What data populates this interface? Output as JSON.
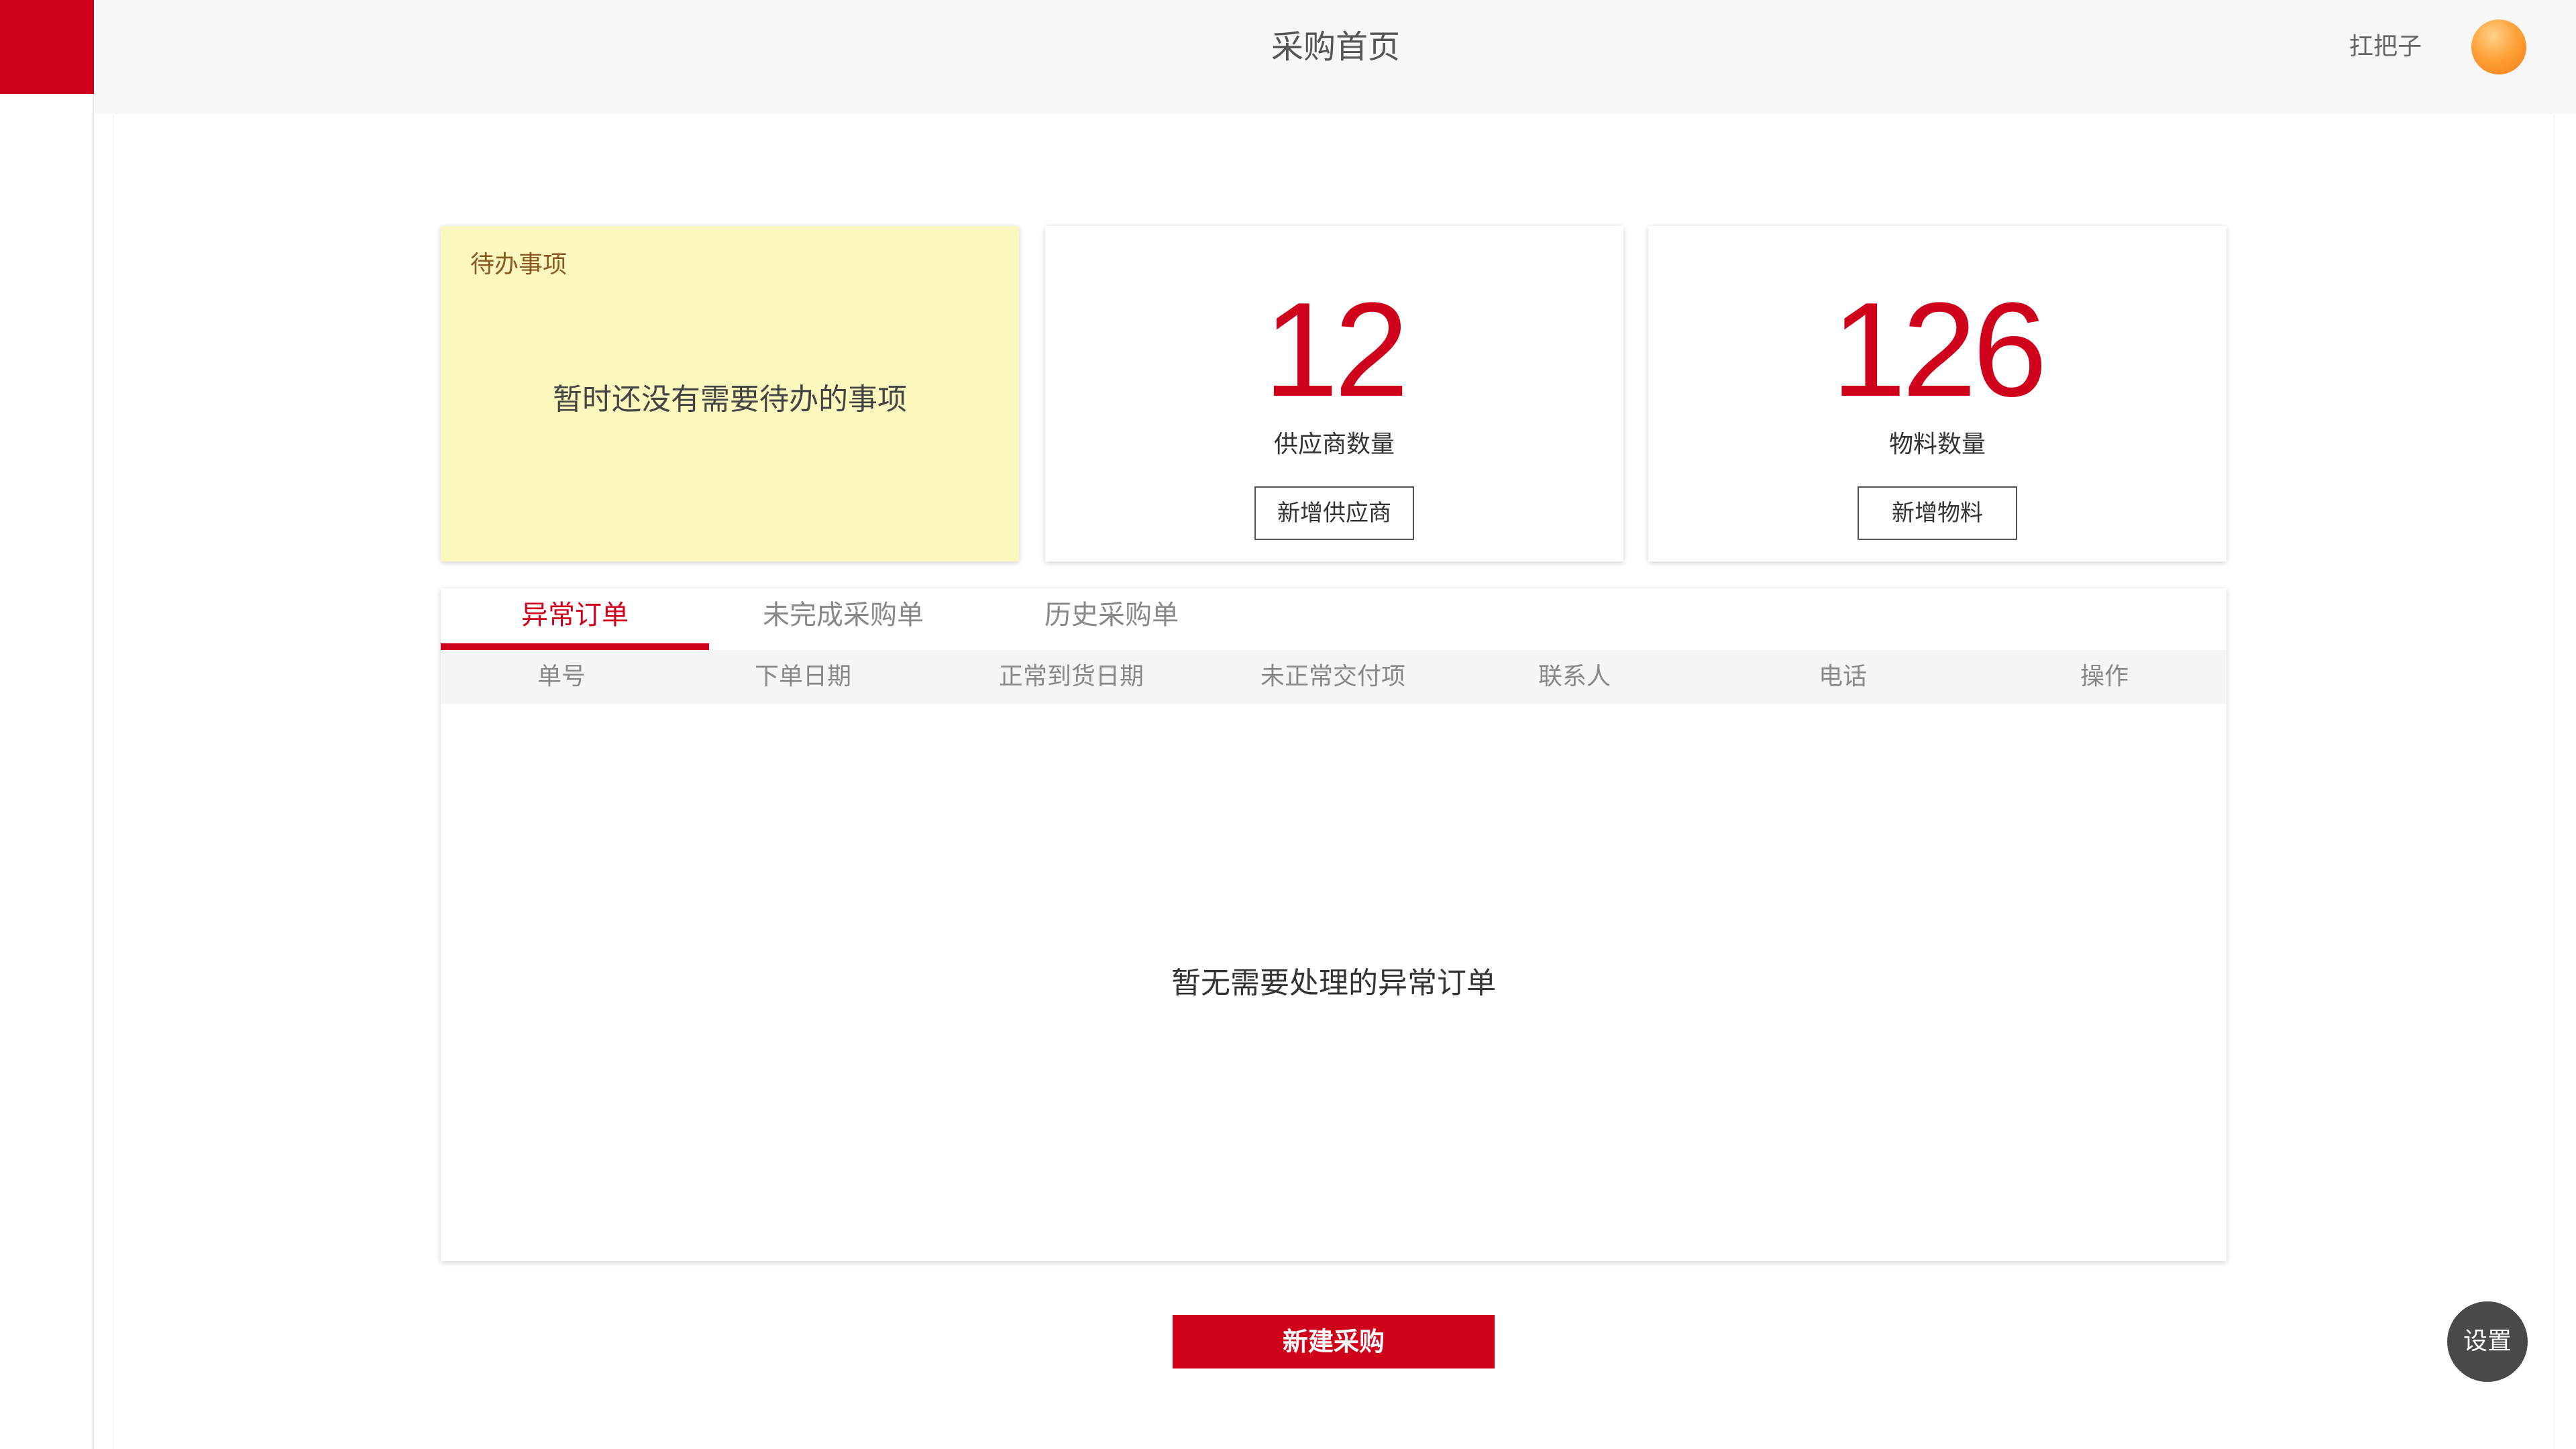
{
  "header": {
    "title": "采购首页",
    "username": "扛把子",
    "avatar_icon": "user-avatar"
  },
  "todo": {
    "title": "待办事项",
    "empty_text": "暂时还没有需要待办的事项"
  },
  "suppliers": {
    "count": "12",
    "label": "供应商数量",
    "button": "新增供应商"
  },
  "materials": {
    "count": "126",
    "label": "物料数量",
    "button": "新增物料"
  },
  "orders": {
    "tabs": [
      {
        "label": "异常订单",
        "active": true
      },
      {
        "label": "未完成采购单",
        "active": false
      },
      {
        "label": "历史采购单",
        "active": false
      }
    ],
    "columns": [
      "单号",
      "下单日期",
      "正常到货日期",
      "未正常交付项",
      "联系人",
      "电话",
      "操作"
    ],
    "empty_text": "暂无需要处理的异常订单"
  },
  "actions": {
    "new_purchase": "新建采购",
    "settings": "设置"
  },
  "colors": {
    "brand": "#d0021b",
    "todo_bg": "#fcf7bd",
    "settings_bg": "#4a4a4a"
  }
}
